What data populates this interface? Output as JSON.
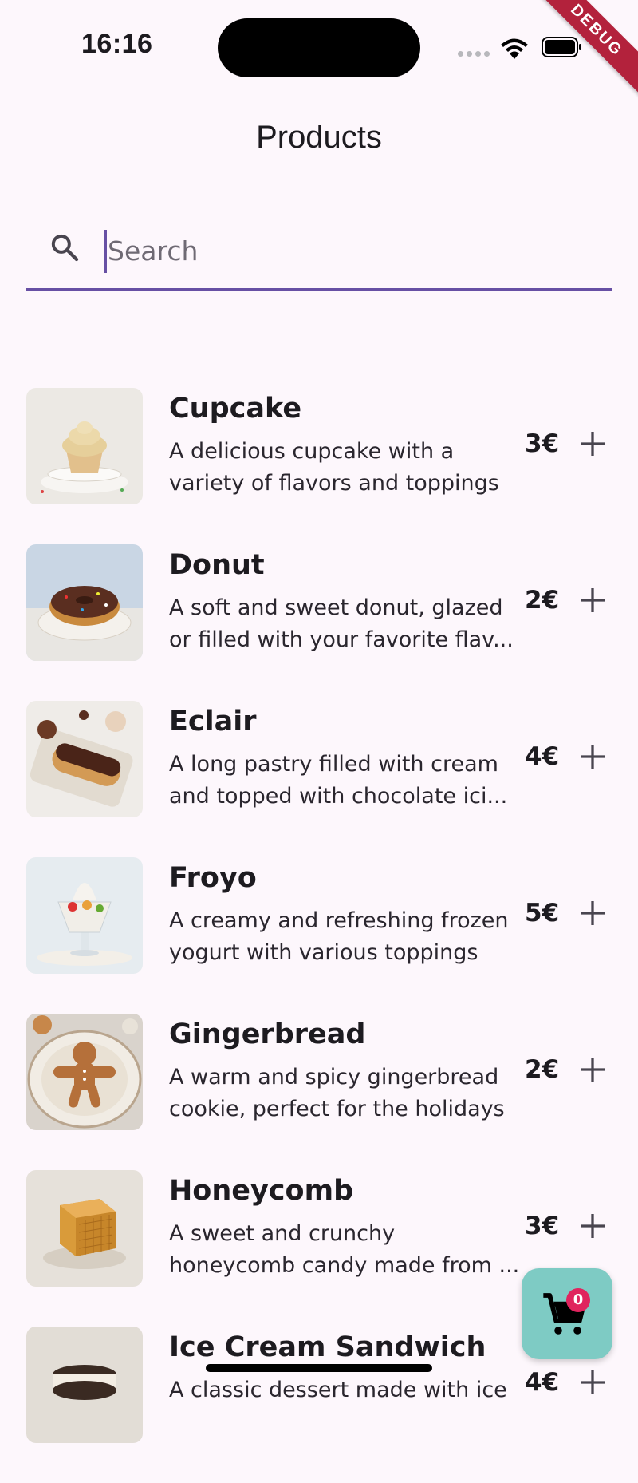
{
  "status_bar": {
    "time": "16:16",
    "debug_label": "DEBUG"
  },
  "header": {
    "title": "Products"
  },
  "search": {
    "placeholder": "Search",
    "value": ""
  },
  "products": [
    {
      "name": "Cupcake",
      "desc_line1": "A delicious cupcake with a",
      "desc_line2": "variety of flavors and toppings",
      "price": "3€",
      "icon": "cupcake"
    },
    {
      "name": "Donut",
      "desc_line1": "A soft and sweet donut, glazed",
      "desc_line2": "or filled with your favorite flav...",
      "price": "2€",
      "icon": "donut"
    },
    {
      "name": "Eclair",
      "desc_line1": "A long pastry filled with cream",
      "desc_line2": "and topped with chocolate ici...",
      "price": "4€",
      "icon": "eclair"
    },
    {
      "name": "Froyo",
      "desc_line1": "A creamy and refreshing frozen",
      "desc_line2": "yogurt with various toppings",
      "price": "5€",
      "icon": "froyo"
    },
    {
      "name": "Gingerbread",
      "desc_line1": "A warm and spicy gingerbread",
      "desc_line2": "cookie, perfect for the holidays",
      "price": "2€",
      "icon": "gingerbread"
    },
    {
      "name": "Honeycomb",
      "desc_line1": "A sweet and crunchy",
      "desc_line2": "honeycomb candy made from ...",
      "price": "3€",
      "icon": "honeycomb"
    },
    {
      "name": "Ice Cream Sandwich",
      "desc_line1": "A classic dessert made with ice",
      "desc_line2": "",
      "price": "4€",
      "icon": "ice-cream-sandwich"
    }
  ],
  "cart": {
    "count": "0"
  },
  "colors": {
    "accent": "#6750a4",
    "fab": "#7ecbc4",
    "badge": "#e0245e",
    "background": "#fdf7fc"
  }
}
